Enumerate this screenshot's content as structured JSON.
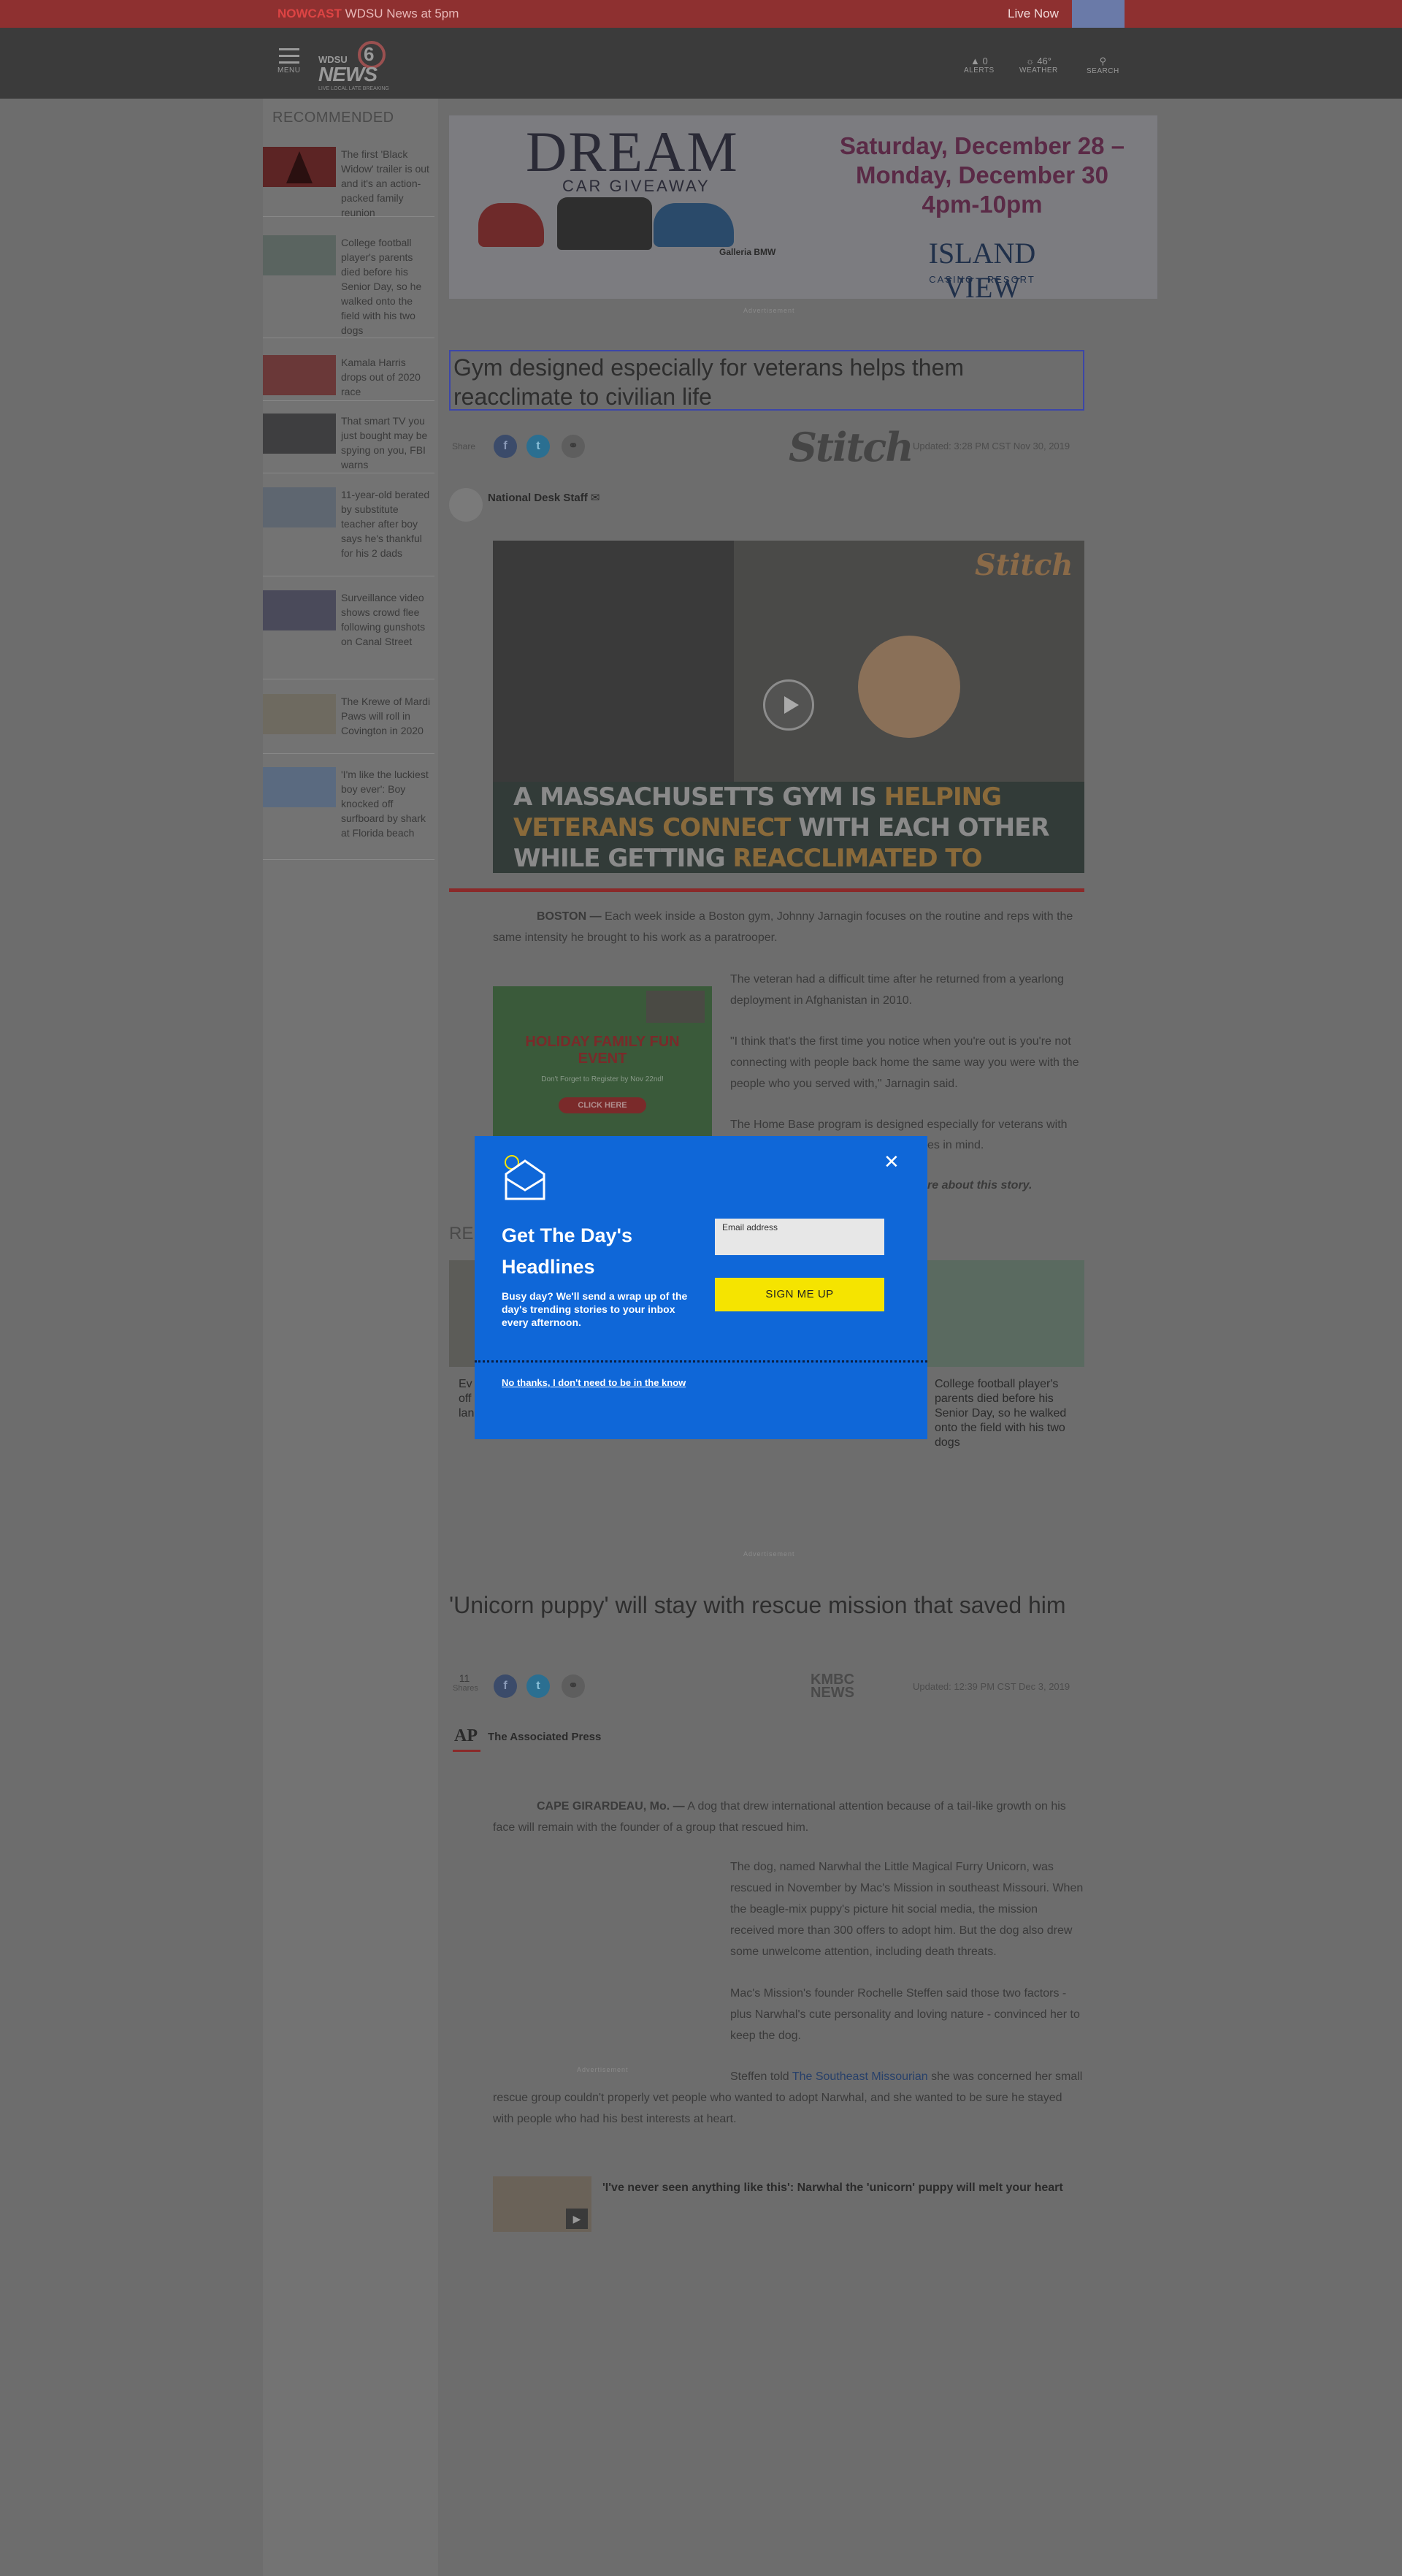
{
  "topbar": {
    "nowcast_label": "NOWCAST",
    "nowcast_text": "WDSU News at 5pm",
    "live_label": "Live Now"
  },
  "header": {
    "menu_label": "MENU",
    "logo_wdsu": "WDSU",
    "logo_news": "NEWS",
    "logo_six": "6",
    "logo_tagline": "LIVE LOCAL LATE BREAKING",
    "alerts_count": "0",
    "alerts_label": "ALERTS",
    "weather_temp": "46°",
    "weather_label": "WEATHER",
    "search_label": "SEARCH"
  },
  "recommended": {
    "title": "RECOMMENDED",
    "items": [
      {
        "text": "The first 'Black Widow' trailer is out and it's an action-packed family reunion"
      },
      {
        "text": "College football player's parents died before his Senior Day, so he walked onto the field with his two dogs"
      },
      {
        "text": "Kamala Harris drops out of 2020 race"
      },
      {
        "text": "That smart TV you just bought may be spying on you, FBI warns"
      },
      {
        "text": "11-year-old berated by substitute teacher after boy says he's thankful for his 2 dads"
      },
      {
        "text": "Surveillance video shows crowd flee following gunshots on Canal Street"
      },
      {
        "text": "The Krewe of Mardi Paws will roll in Covington in 2020"
      },
      {
        "text": "'I'm like the luckiest boy ever': Boy knocked off surfboard by shark at Florida beach"
      }
    ]
  },
  "ad_banner": {
    "dream": "DREAM",
    "car_giveaway": "CAR GIVEAWAY",
    "dates_line1": "Saturday, December 28 –",
    "dates_line2": "Monday, December 30",
    "time": "4pm-10pm",
    "venue": "ISLAND VIEW",
    "venue_sub": "CASINO • RESORT",
    "sponsor": "Galleria BMW",
    "label": "Advertisement"
  },
  "article1": {
    "headline": "Gym designed especially for veterans helps them reacclimate to civilian life",
    "share_label": "Share",
    "source_logo": "Stitch",
    "updated": "Updated: 3:28 PM CST Nov 30, 2019",
    "author": "National Desk Staff",
    "video_overlay_1": "A MASSACHUSETTS GYM IS ",
    "video_overlay_hl1": "HELPING VETERANS CONNECT",
    "video_overlay_2": " WITH EACH OTHER WHILE GETTING ",
    "video_overlay_hl2": "REACCLIMATED TO CIVILIAN LIFE.",
    "video_watermark": "Stitch",
    "dateline": "BOSTON —",
    "p1": " Each week inside a Boston gym, Johnny Jarnagin focuses on the routine and reps with the same intensity he brought to his work as a paratrooper.",
    "p2": "The veteran had a difficult time after he returned from a yearlong deployment in Afghanistan in 2010.",
    "p3": "\"I think that's the first time you notice when you're out is you're not connecting with people back home the same way you were with the people who you served with,\" Jarnagin said.",
    "p4": "The Home Base program is designed especially for veterans with",
    "p4b": "es in mind.",
    "more": "re about this story.",
    "inline_ad_title": "HOLIDAY FAMILY FUN EVENT",
    "inline_ad_sub": "Don't Forget to Register by Nov 22nd!",
    "inline_ad_btn": "CLICK HERE",
    "rec_heading": "RE",
    "rec_left_text": "Ev off lan",
    "rec_right_text": "College football player's parents died before his Senior Day, so he walked onto the field with his two dogs"
  },
  "modal": {
    "title": "Get The Day's Headlines",
    "desc": "Busy day? We'll send a wrap up of the day's trending stories to your inbox every afternoon.",
    "email_label": "Email address",
    "signup": "SIGN ME UP",
    "no_thanks": "No thanks, I don't need to be in the know"
  },
  "ad2_label": "Advertisement",
  "article2": {
    "headline": "'Unicorn puppy' will stay with rescue mission that saved him",
    "shares_count": "11",
    "shares_label": "Shares",
    "source_logo": "KMBC NEWS",
    "updated": "Updated: 12:39 PM CST Dec 3, 2019",
    "author_logo": "AP",
    "author": "The Associated Press",
    "dateline": "CAPE GIRARDEAU, Mo. —",
    "p1": " A dog that drew international attention because of a tail-like growth on his face will remain with the founder of a group that rescued him.",
    "p2": "The dog, named Narwhal the Little Magical Furry Unicorn, was rescued in November by Mac's Mission in southeast Missouri. When the beagle-mix puppy's picture hit social media, the mission received more than 300 offers to adopt him. But the dog also drew some unwelcome attention, including death threats.",
    "p3": "Mac's Mission's founder Rochelle Steffen said those two factors - plus Narwhal's cute personality and loving nature - convinced her to keep the dog.",
    "p4_a": "Steffen told ",
    "p4_link": "The Southeast Missourian",
    "p4_b": " she was concerned her small rescue group couldn't properly vet people who wanted to adopt Narwhal, and she wanted to be sure he stayed with people who had his best interests at heart.",
    "ad_label": "Advertisement",
    "related_title": "'I've never seen anything like this': Narwhal the 'unicorn' puppy will melt your heart"
  },
  "colors": {
    "modal_blue": "#0f67d8",
    "signup_yellow": "#f5e400",
    "topbar_red": "#8e3030"
  }
}
